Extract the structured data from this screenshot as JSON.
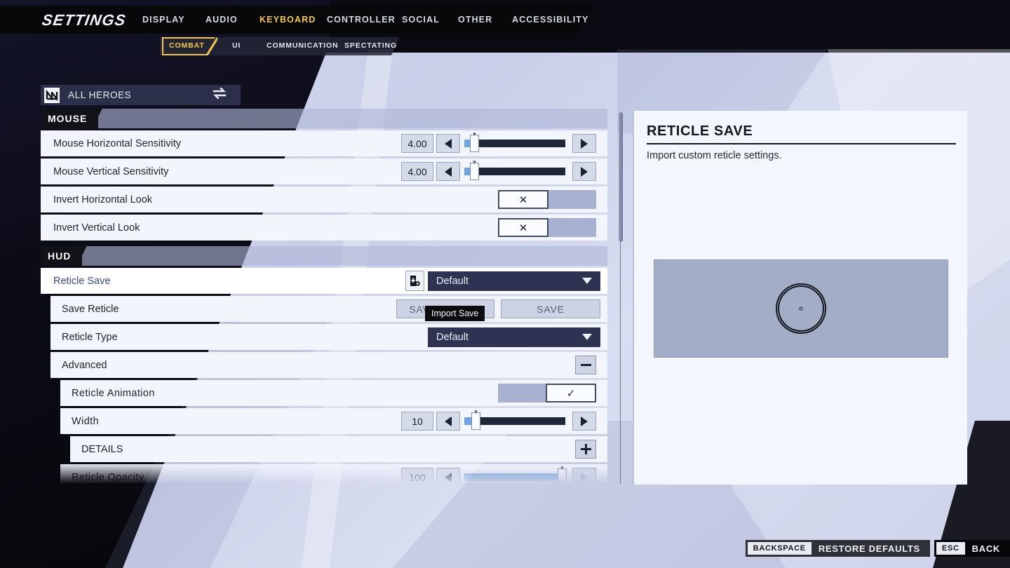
{
  "header": {
    "title": "SETTINGS",
    "main_tabs": [
      {
        "label": "DISPLAY",
        "active": false
      },
      {
        "label": "AUDIO",
        "active": false
      },
      {
        "label": "KEYBOARD",
        "active": true
      },
      {
        "label": "CONTROLLER",
        "active": false
      },
      {
        "label": "SOCIAL",
        "active": false
      },
      {
        "label": "OTHER",
        "active": false
      },
      {
        "label": "ACCESSIBILITY",
        "active": false
      }
    ],
    "sub_tabs": [
      {
        "label": "COMBAT",
        "active": true
      },
      {
        "label": "UI",
        "active": false
      },
      {
        "label": "COMMUNICATION",
        "active": false
      },
      {
        "label": "SPECTATING",
        "active": false
      }
    ],
    "accent_color": "#f2c94c"
  },
  "hero_selector": {
    "label": "ALL HEROES",
    "icon": "all-heroes-icon",
    "swap_icon": "swap-arrows-icon"
  },
  "sections": [
    {
      "name": "MOUSE",
      "rows": [
        {
          "label": "Mouse Horizontal Sensitivity",
          "type": "slider",
          "value": "4.00",
          "fill_pct": 5
        },
        {
          "label": "Mouse Vertical Sensitivity",
          "type": "slider",
          "value": "4.00",
          "fill_pct": 5
        },
        {
          "label": "Invert Horizontal Look",
          "type": "toggle",
          "checked": false
        },
        {
          "label": "Invert Vertical Look",
          "type": "toggle",
          "checked": false
        }
      ]
    },
    {
      "name": "HUD",
      "rows": [
        {
          "label": "Reticle Save",
          "type": "dropdown-import",
          "value": "Default",
          "highlighted": true,
          "icon": "import-save-icon"
        },
        {
          "label": "Save Reticle",
          "type": "buttons",
          "buttons": [
            "SAVE AS NEW",
            "SAVE"
          ]
        },
        {
          "label": "Reticle Type",
          "type": "dropdown",
          "value": "Default"
        },
        {
          "label": "Advanced",
          "type": "collapse",
          "glyph": "minus",
          "expanded": true
        },
        {
          "label": "Reticle Animation",
          "type": "toggle",
          "checked": true,
          "indent": 1
        },
        {
          "label": "Width",
          "type": "slider",
          "value": "10",
          "fill_pct": 7,
          "indent": 1
        },
        {
          "label": "DETAILS",
          "type": "collapse",
          "glyph": "plus",
          "expanded": false,
          "indent": 2
        },
        {
          "label": "Reticle Opacity",
          "type": "slider",
          "value": "100",
          "fill_pct": 100,
          "indent": 1,
          "right_dim": true
        }
      ]
    }
  ],
  "tooltip": {
    "text": "Import Save"
  },
  "info_panel": {
    "title": "RETICLE SAVE",
    "description": "Import custom reticle settings.",
    "preview": {
      "reticle_name": "reticle-preview"
    }
  },
  "bottom_bar": [
    {
      "key": "BACKSPACE",
      "action": "RESTORE DEFAULTS",
      "style": "grey"
    },
    {
      "key": "ESC",
      "action": "BACK",
      "style": "black"
    }
  ]
}
